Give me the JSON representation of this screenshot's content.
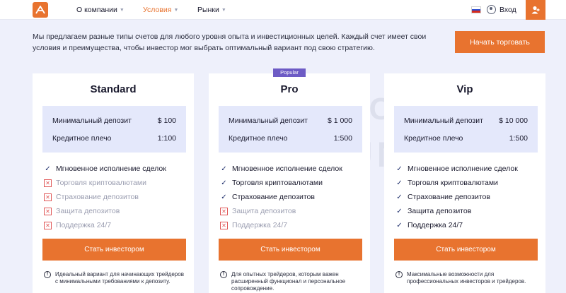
{
  "header": {
    "nav": [
      "О компании",
      "Условия",
      "Рынки"
    ],
    "login": "Вход",
    "icons": {
      "logo": "logo-icon",
      "flag": "ru-flag-icon",
      "user": "user-icon",
      "users": "users-icon"
    }
  },
  "intro": {
    "text": "Мы предлагаем разные типы счетов для любого уровня опыта и инвестиционных целей. Каждый счет имеет свои условия и преимущества, чтобы инвестор мог выбрать оптимальный вариант под свою стратегию.",
    "button": "Начать торговать"
  },
  "watermark": {
    "line1": "BROKER",
    "line2": "TRIBUNAL"
  },
  "plans": [
    {
      "name": "Standard",
      "min_deposit_label": "Минимальный депозит",
      "min_deposit": "$ 100",
      "leverage_label": "Кредитное плечо",
      "leverage": "1:100",
      "features": [
        {
          "text": "Мгновенное исполнение сделок",
          "enabled": true
        },
        {
          "text": "Торговля криптовалютами",
          "enabled": false
        },
        {
          "text": "Страхование депозитов",
          "enabled": false
        },
        {
          "text": "Защита депозитов",
          "enabled": false
        },
        {
          "text": "Поддержка 24/7",
          "enabled": false
        }
      ],
      "button": "Стать инвестором",
      "note": "Идеальный вариант для начинающих трейдеров с минимальными требованиями к депозиту."
    },
    {
      "name": "Pro",
      "badge": "Popular",
      "min_deposit_label": "Минимальный депозит",
      "min_deposit": "$ 1 000",
      "leverage_label": "Кредитное плечо",
      "leverage": "1:500",
      "features": [
        {
          "text": "Мгновенное исполнение сделок",
          "enabled": true
        },
        {
          "text": "Торговля криптовалютами",
          "enabled": true
        },
        {
          "text": "Страхование депозитов",
          "enabled": true
        },
        {
          "text": "Защита депозитов",
          "enabled": false
        },
        {
          "text": "Поддержка 24/7",
          "enabled": false
        }
      ],
      "button": "Стать инвестором",
      "note": "Для опытных трейдеров, которым важен расширенный функционал и персональное сопровождение."
    },
    {
      "name": "Vip",
      "min_deposit_label": "Минимальный депозит",
      "min_deposit": "$ 10 000",
      "leverage_label": "Кредитное плечо",
      "leverage": "1:500",
      "features": [
        {
          "text": "Мгновенное исполнение сделок",
          "enabled": true
        },
        {
          "text": "Торговля криптовалютами",
          "enabled": true
        },
        {
          "text": "Страхование депозитов",
          "enabled": true
        },
        {
          "text": "Защита депозитов",
          "enabled": true
        },
        {
          "text": "Поддержка 24/7",
          "enabled": true
        }
      ],
      "button": "Стать инвестором",
      "note": "Максимальные возможности для профессиональных инвесторов и трейдеров."
    }
  ],
  "colors": {
    "accent": "#e8732f",
    "badge": "#6d5bc5",
    "background": "#eef0fb",
    "stats_bg": "#e4e8fb"
  }
}
